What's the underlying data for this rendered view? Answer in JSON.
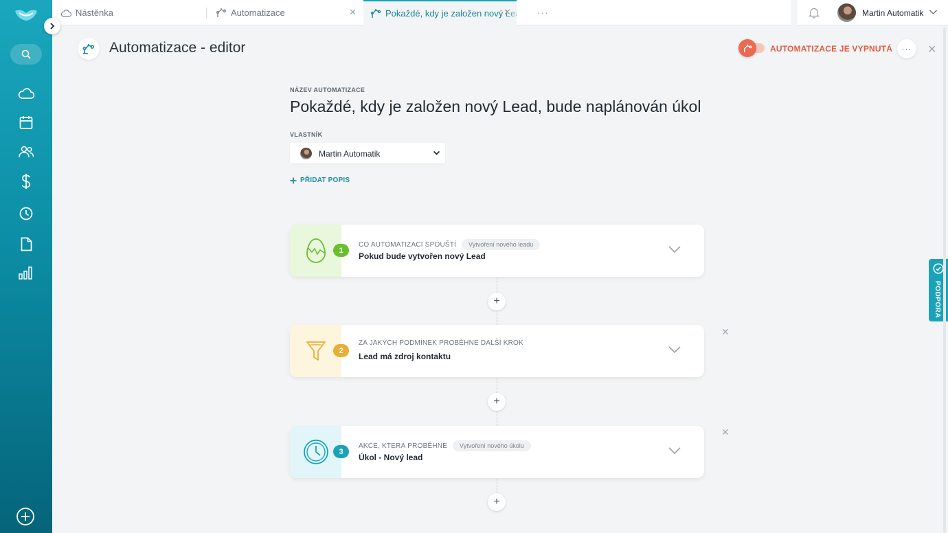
{
  "tabs": [
    {
      "label": "Nástěnka",
      "icon": "cloud-icon"
    },
    {
      "label": "Automatizace",
      "icon": "automation-icon"
    },
    {
      "label": "Pokaždé, kdy je založen nový Lead",
      "icon": "automation-icon",
      "active": true
    }
  ],
  "tabs_more": "···",
  "user": {
    "name": "Martin Automatik"
  },
  "header": {
    "title": "Automatizace - editor",
    "status": "AUTOMATIZACE JE VYPNUTÁ",
    "status_color": "#e05b43",
    "more": "···",
    "close": "✕"
  },
  "form": {
    "name_label": "NÁZEV AUTOMATIZACE",
    "name_value": "Pokaždé, kdy je založen nový Lead, bude naplánován úkol",
    "owner_label": "VLASTNÍK",
    "owner_value": "Martin Automatik",
    "add_description": "PŘIDAT POPIS"
  },
  "steps": [
    {
      "number": "1",
      "caption": "CO AUTOMATIZACI SPOUŠTÍ",
      "tag": "Vytvoření nového leadu",
      "title": "Pokud bude vytvořen nový Lead",
      "icon": "lead-egg-icon",
      "color": "#6abf2e",
      "bg": "#e9f7dd"
    },
    {
      "number": "2",
      "caption": "ZA JAKÝCH PODMÍNEK PROBĚHNE DALŠÍ KROK",
      "tag": "",
      "title": "Lead má zdroj kontaktu",
      "icon": "filter-icon",
      "color": "#e8ae35",
      "bg": "#fdf5dd"
    },
    {
      "number": "3",
      "caption": "AKCE, KTERÁ PROBĚHNE",
      "tag": "Vytvoření nového úkolu",
      "title": "Úkol - Nový lead",
      "icon": "clock-icon",
      "color": "#1aa3b8",
      "bg": "#e2f5f8"
    }
  ],
  "add_step": "+",
  "remove_step": "✕",
  "help": {
    "label": "PODPORA"
  },
  "colors": {
    "accent": "#14a3b8",
    "sidebar": "#0c8ea6"
  }
}
